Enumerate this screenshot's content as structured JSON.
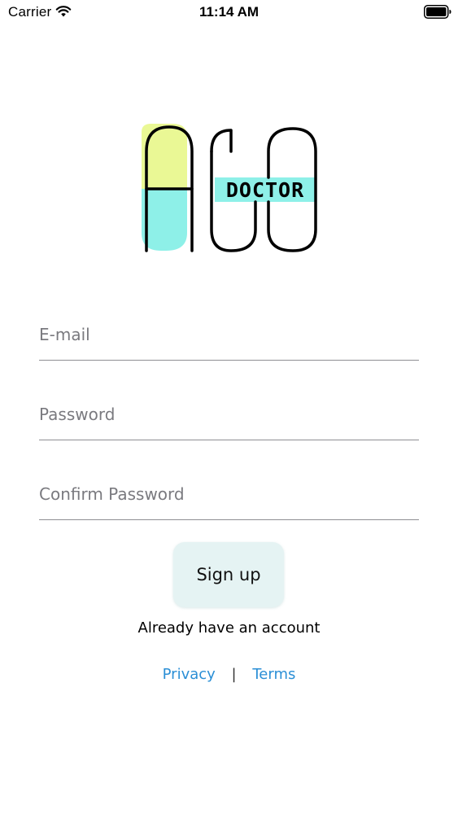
{
  "status_bar": {
    "carrier": "Carrier",
    "time": "11:14 AM",
    "wifi_icon": "wifi-icon",
    "battery_icon": "battery-icon"
  },
  "logo": {
    "letters": "ALO",
    "word": "DOCTOR",
    "colors": {
      "capsule_top": "#eaf895",
      "capsule_bottom": "#8ef0e8",
      "banner": "#8ef0e8",
      "stroke": "#000000"
    }
  },
  "form": {
    "email_placeholder": "E-mail",
    "password_placeholder": "Password",
    "confirm_placeholder": "Confirm Password",
    "email_value": "",
    "password_value": "",
    "confirm_value": ""
  },
  "signup_label": "Sign up",
  "already_account": "Already have an account",
  "footer": {
    "privacy": "Privacy",
    "separator": "|",
    "terms": "Terms"
  },
  "colors": {
    "link": "#2b8fd6",
    "button_bg": "#e5f3f3",
    "field_line": "#8e8e93"
  }
}
